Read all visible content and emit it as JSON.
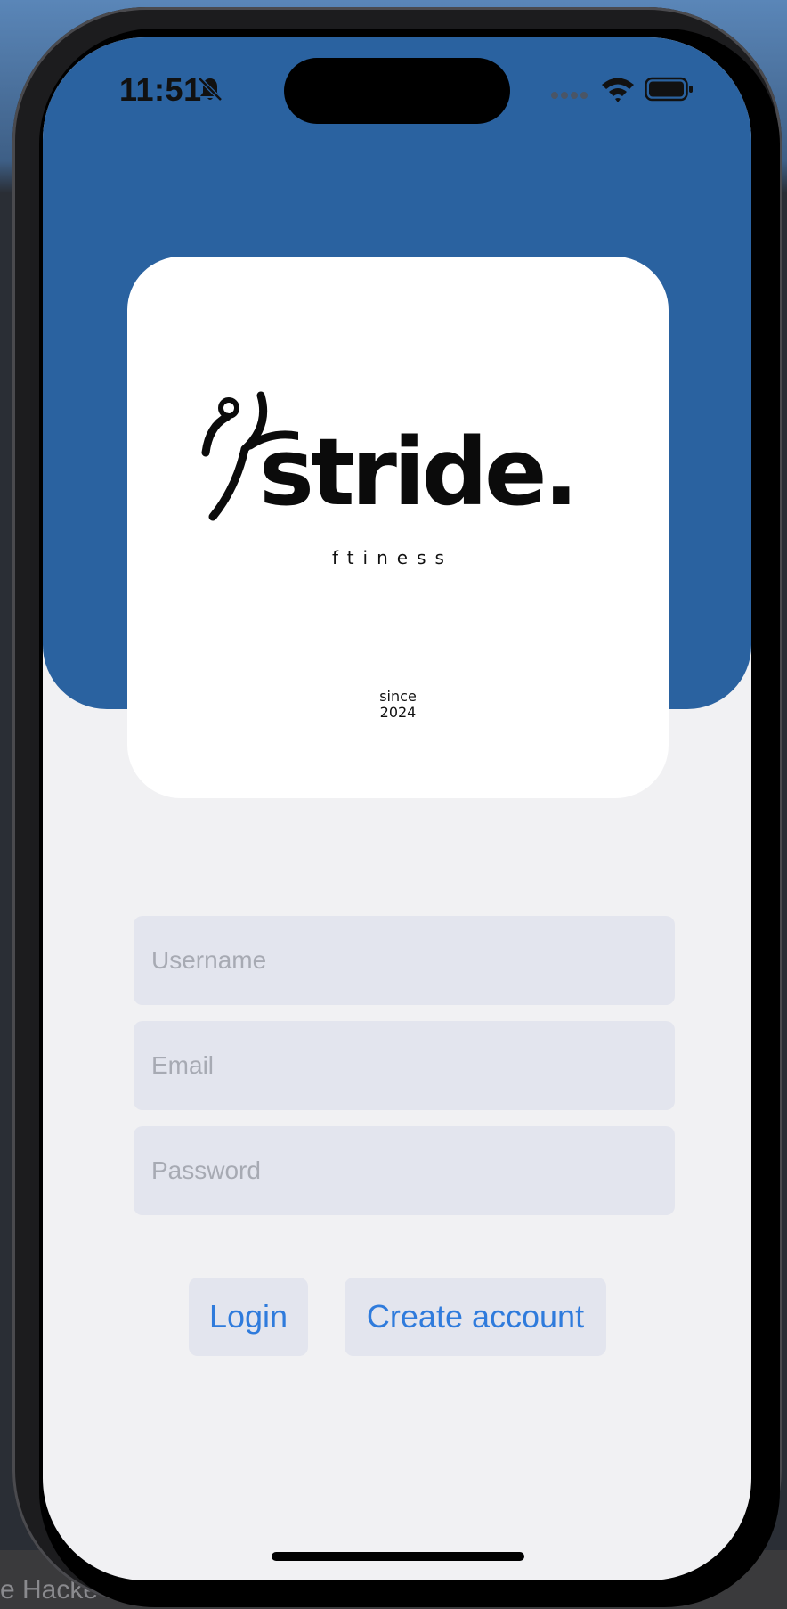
{
  "status_bar": {
    "time": "11:51",
    "icons": [
      "bell-slash-icon",
      "signal-icon",
      "wifi-icon",
      "battery-icon"
    ]
  },
  "brand": {
    "name": "stride.",
    "tagline": "ftiness",
    "since_label": "since",
    "since_year": "2024"
  },
  "form": {
    "username_placeholder": "Username",
    "email_placeholder": "Email",
    "password_placeholder": "Password"
  },
  "actions": {
    "login_label": "Login",
    "create_label": "Create account"
  },
  "background": {
    "text": "e Hacke"
  },
  "colors": {
    "header_blue": "#2a62a0",
    "screen_bg": "#f1f1f3",
    "field_bg": "#e3e5ee",
    "button_text": "#2f7bdc",
    "placeholder": "#a7aab3"
  }
}
